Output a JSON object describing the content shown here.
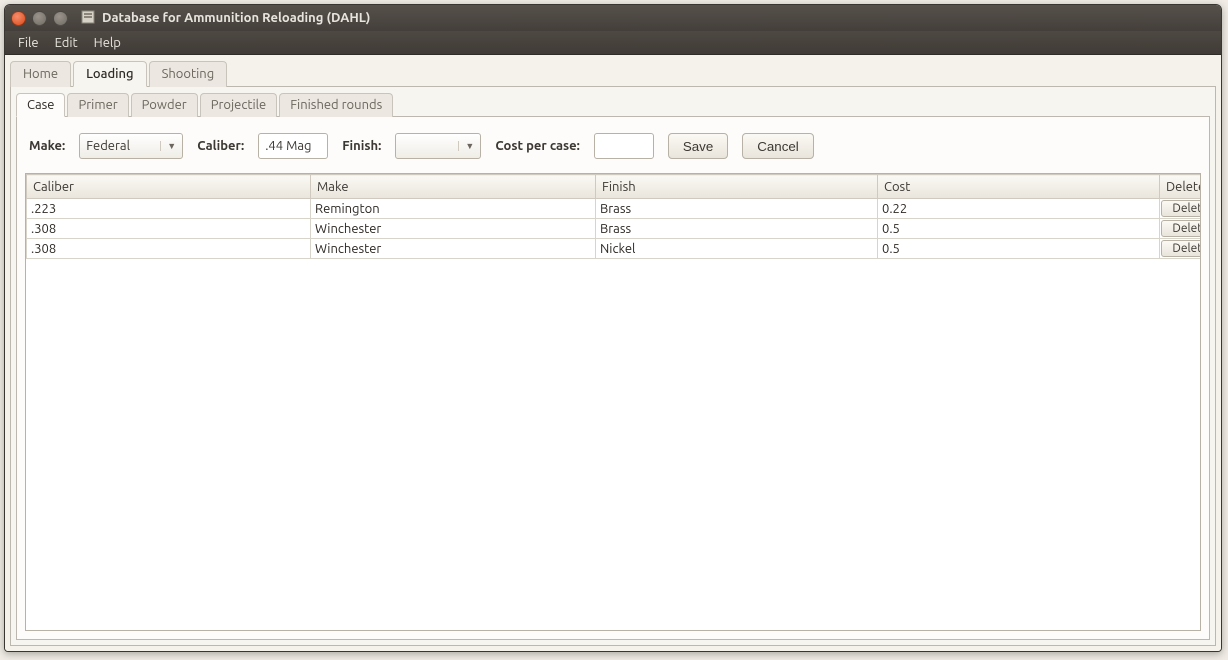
{
  "window": {
    "title": "Database for Ammunition Reloading (DAHL)"
  },
  "menubar": {
    "file": "File",
    "edit": "Edit",
    "help": "Help"
  },
  "main_tabs": {
    "home": "Home",
    "loading": "Loading",
    "shooting": "Shooting"
  },
  "sub_tabs": {
    "case": "Case",
    "primer": "Primer",
    "powder": "Powder",
    "projectile": "Projectile",
    "finished": "Finished rounds"
  },
  "form": {
    "make_label": "Make:",
    "make_value": "Federal",
    "caliber_label": "Caliber:",
    "caliber_value": ".44 Mag",
    "finish_label": "Finish:",
    "finish_value": "",
    "cost_label": "Cost per case:",
    "cost_value": "",
    "save": "Save",
    "cancel": "Cancel"
  },
  "table": {
    "headers": {
      "caliber": "Caliber",
      "make": "Make",
      "finish": "Finish",
      "cost": "Cost",
      "delete": "Delete"
    },
    "rows": [
      {
        "caliber": ".223",
        "make": "Remington",
        "finish": "Brass",
        "cost": "0.22",
        "delete": "Delete"
      },
      {
        "caliber": ".308",
        "make": "Winchester",
        "finish": "Brass",
        "cost": "0.5",
        "delete": "Delete"
      },
      {
        "caliber": ".308",
        "make": "Winchester",
        "finish": "Nickel",
        "cost": "0.5",
        "delete": "Delete"
      }
    ]
  }
}
